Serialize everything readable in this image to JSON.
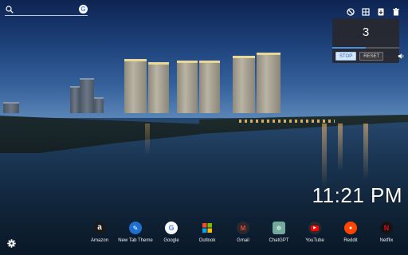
{
  "search": {
    "placeholder": "",
    "engine_letter": "G"
  },
  "toolbar": {
    "icons": [
      "no-ads-icon",
      "grid-icon",
      "download-icon",
      "trash-icon"
    ]
  },
  "timer": {
    "value": "3",
    "progress_fraction": 0.5,
    "stop_label": "STOP",
    "reset_label": "RESET",
    "accent": "#4a90e2"
  },
  "clock": {
    "time": "11:21 PM"
  },
  "shortcuts": [
    {
      "label": "Amazon",
      "icon": "amazon-icon",
      "glyph": "a"
    },
    {
      "label": "New Tab Theme",
      "icon": "new-tab-theme-icon",
      "glyph": "✎"
    },
    {
      "label": "Google",
      "icon": "google-icon",
      "glyph": "G"
    },
    {
      "label": "Outlook",
      "icon": "outlook-icon",
      "glyph": ""
    },
    {
      "label": "Gmail",
      "icon": "gmail-icon",
      "glyph": "M"
    },
    {
      "label": "ChatGPT",
      "icon": "chatgpt-icon",
      "glyph": "✲"
    },
    {
      "label": "YouTube",
      "icon": "youtube-icon",
      "glyph": "▶"
    },
    {
      "label": "Reddit",
      "icon": "reddit-icon",
      "glyph": "●"
    },
    {
      "label": "Netflix",
      "icon": "netflix-icon",
      "glyph": "N"
    }
  ]
}
